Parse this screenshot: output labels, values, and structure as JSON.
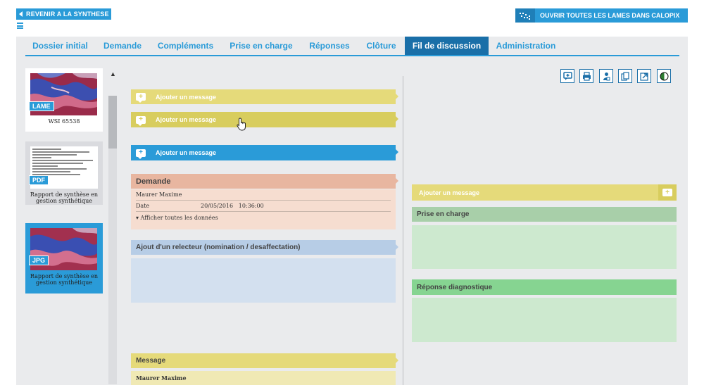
{
  "header": {
    "back_label": "REVENIR A LA SYNTHESE",
    "calopix_label": "OUVRIR TOUTES LES LAMES DANS CALOPIX"
  },
  "tabs": [
    {
      "label": "Dossier initial"
    },
    {
      "label": "Demande"
    },
    {
      "label": "Compléments"
    },
    {
      "label": "Prise en charge"
    },
    {
      "label": "Réponses"
    },
    {
      "label": "Clôture"
    },
    {
      "label": "Fil de discussion",
      "active": true
    },
    {
      "label": "Administration"
    }
  ],
  "sidebar": {
    "items": [
      {
        "badge": "LAME",
        "caption": "WSI 65538",
        "kind": "slide"
      },
      {
        "badge": "PDF",
        "caption": "Rapport de synthèse en gestion synthétique",
        "kind": "pdf"
      },
      {
        "badge": "JPG",
        "caption": "Rapport de synthèse en gestion synthétique",
        "kind": "image",
        "selected": true
      }
    ]
  },
  "toolbar": {
    "icons": [
      "add-comment-icon",
      "print-icon",
      "user-lock-icon",
      "copy-icon",
      "export-icon",
      "contrast-icon"
    ]
  },
  "thread": {
    "add_message_1": "Ajouter un message",
    "add_message_2": "Ajouter un message",
    "add_message_3": "Ajouter un message",
    "demande": {
      "title": "Demande",
      "author": "Maurer Maxime",
      "date_label": "Date",
      "date_value": "20/05/2016   10:36:00",
      "show_all": "▾ Afficher toutes les données"
    },
    "relecteur_title": "Ajout d'un relecteur (nomination / desaffectation)",
    "message": {
      "title": "Message",
      "author": "Maurer Maxime"
    }
  },
  "right_panel": {
    "add_message": "Ajouter un message",
    "prise_en_charge": "Prise en charge",
    "reponse": "Réponse diagnostique"
  },
  "colors": {
    "accent": "#2a9bd8",
    "tab_active": "#1a6fa8",
    "yellow": "#e5da7a",
    "salmon": "#e8b6a0",
    "light_blue": "#b7cde6",
    "green": "#86d491"
  }
}
